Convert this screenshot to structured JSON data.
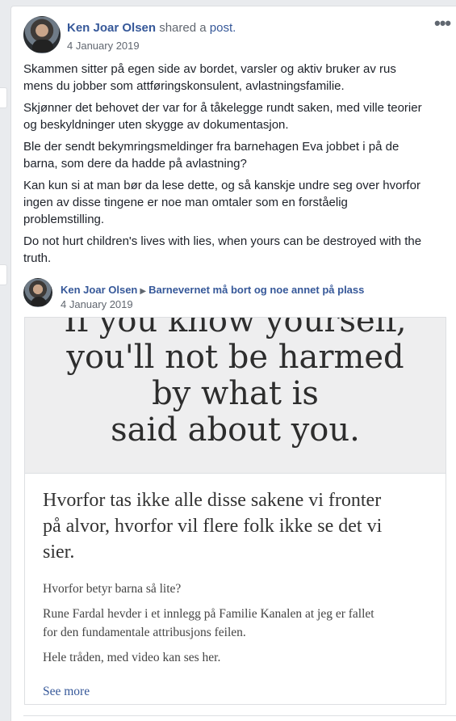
{
  "post": {
    "author": "Ken Joar Olsen",
    "shared_text": " shared a ",
    "shared_link": "post.",
    "date": "4 January 2019",
    "more_icon": "more-horizontal-icon",
    "paragraphs": [
      "Skammen sitter på egen side av bordet, varsler og aktiv bruker av rus\nmens du jobber som attføringskonsulent, avlastningsfamilie.",
      "Skjønner det behovet der var for å tåkelegge rundt saken, med ville teorier\nog beskyldninger uten skygge av dokumentasjon.",
      "Ble der sendt bekymringsmeldinger fra barnehagen Eva jobbet i på de\nbarna, som dere da hadde på avlastning?",
      "Kan kun si at man bør da lese dette, og så kanskje undre seg over hvorfor\ningen av disse tingene er noe man omtaler som en forståelig\nproblemstilling.",
      "Do not hurt children's lives with lies, when yours can be destroyed with the\ntruth."
    ]
  },
  "shared": {
    "author": "Ken Joar Olsen",
    "arrow_icon": "caret-right-icon",
    "group": "Barnevernet må bort og noe annet på plass",
    "date": "4 January 2019"
  },
  "attachment": {
    "quote": "If you know yourself,\nyou'll not be harmed\nby what is\nsaid about you.",
    "title": "Hvorfor tas ikke alle disse sakene vi fronter\npå alvor, hvorfor vil flere folk ikke se det vi\nsier.",
    "paragraphs": [
      "Hvorfor betyr barna så lite?",
      "Rune Fardal hevder i et innlegg på Familie Kanalen at jeg er fallet\nfor den fundamentale attribusjons feilen.",
      "Hele tråden, med video kan ses her."
    ],
    "see_more": "See more"
  },
  "colors": {
    "link": "#365899",
    "meta": "#616770",
    "background": "#e9ebee"
  }
}
